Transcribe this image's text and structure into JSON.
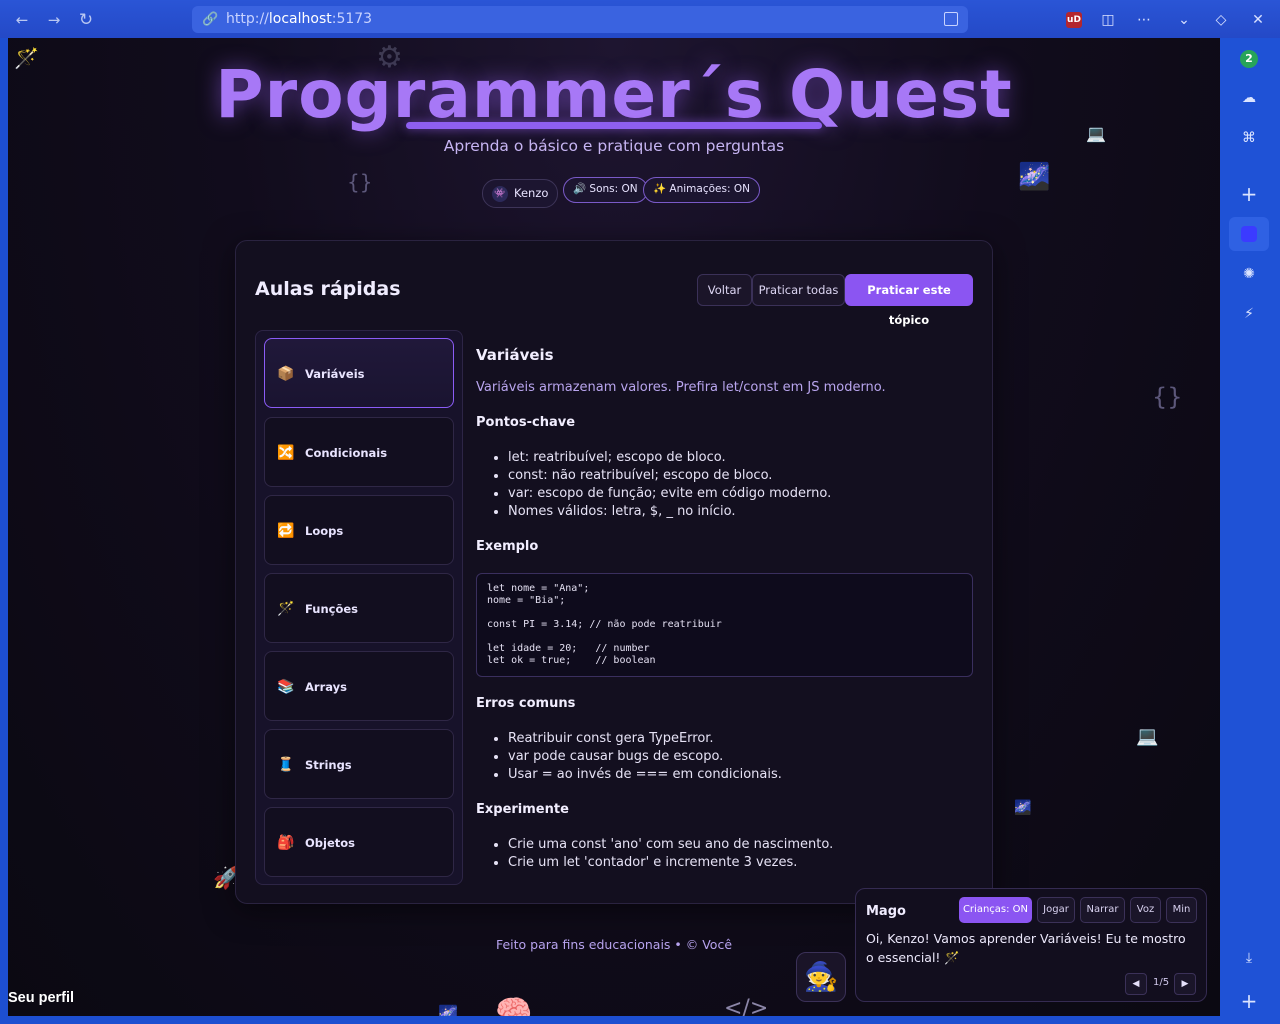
{
  "browser": {
    "url_scheme": "http://",
    "url_host": "localhost",
    "url_port": ":5173",
    "ublock_label": "uD",
    "sidebar_badge": "2"
  },
  "header": {
    "title": "Programmer´s Quest",
    "subtitle": "Aprenda o básico e pratique com perguntas",
    "user_name": "Kenzo",
    "sounds_toggle": "🔊 Sons: ON",
    "animations_toggle": "✨ Animações: ON"
  },
  "card": {
    "title": "Aulas rápidas",
    "buttons": {
      "back": "Voltar",
      "practice_all": "Praticar todas",
      "practice_topic": "Praticar este tópico"
    },
    "topics": [
      {
        "icon": "📦",
        "label": "Variáveis"
      },
      {
        "icon": "🔀",
        "label": "Condicionais"
      },
      {
        "icon": "🔁",
        "label": "Loops"
      },
      {
        "icon": "🪄",
        "label": "Funções"
      },
      {
        "icon": "📚",
        "label": "Arrays"
      },
      {
        "icon": "🧵",
        "label": "Strings"
      },
      {
        "icon": "🎒",
        "label": "Objetos"
      }
    ],
    "lesson": {
      "title": "Variáveis",
      "intro": "Variáveis armazenam valores. Prefira let/const em JS moderno.",
      "key_points_title": "Pontos-chave",
      "key_points": [
        "let: reatribuível; escopo de bloco.",
        "const: não reatribuível; escopo de bloco.",
        "var: escopo de função; evite em código moderno.",
        "Nomes válidos: letra, $, _ no início."
      ],
      "example_title": "Exemplo",
      "example_code": "let nome = \"Ana\";\nnome = \"Bia\";\n\nconst PI = 3.14; // não pode reatribuir\n\nlet idade = 20;   // number\nlet ok = true;    // boolean",
      "errors_title": "Erros comuns",
      "errors": [
        "Reatribuir const gera TypeError.",
        "var pode causar bugs de escopo.",
        "Usar = ao invés de === em condicionais."
      ],
      "try_title": "Experimente",
      "try_items": [
        "Crie uma const 'ano' com seu ano de nascimento.",
        "Crie um let 'contador' e incremente 3 vezes."
      ]
    }
  },
  "footer": "Feito para fins educacionais • © Você",
  "profile_label": "Seu perfil",
  "mago": {
    "title": "Mago",
    "kids_toggle": "Crianças: ON",
    "play": "Jogar",
    "narrate": "Narrar",
    "voice": "Voz",
    "minimize": "Min",
    "message": "Oi, Kenzo! Vamos aprender Variáveis! Eu te mostro o essencial! 🪄",
    "page": "1/5"
  },
  "colors": {
    "accent": "#8b55f2",
    "title": "#a778f6",
    "background": "#110c1c",
    "browser": "#2449c7"
  }
}
